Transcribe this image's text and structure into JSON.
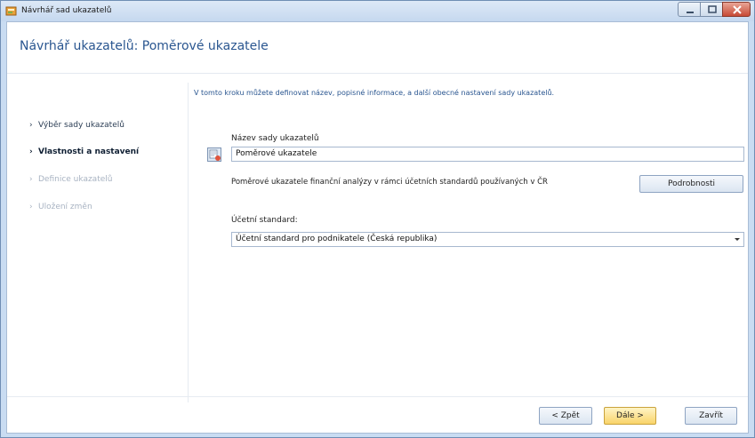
{
  "window": {
    "title": "Návrhář sad ukazatelů",
    "controls": {
      "minimize": "minimize-icon",
      "maximize": "maximize-icon",
      "close": "close-icon"
    }
  },
  "header": {
    "title": "Návrhář ukazatelů: Poměrové ukazatele"
  },
  "steps": [
    {
      "label": "Výběr sady ukazatelů",
      "state": "done"
    },
    {
      "label": "Vlastnosti a nastavení",
      "state": "active"
    },
    {
      "label": "Definice ukazatelů",
      "state": "disabled"
    },
    {
      "label": "Uložení změn",
      "state": "disabled"
    }
  ],
  "content": {
    "intro": "V tomto kroku můžete definovat název, popisné informace, a další obecné nastavení sady ukazatelů.",
    "name_label": "Název sady ukazatelů",
    "name_value": "Poměrové ukazatele",
    "description": "Poměrové ukazatele finanční analýzy v rámci účetních standardů používaných v ČR",
    "details_button": "Podrobnosti",
    "standard_label": "Účetní standard:",
    "standard_value": "Účetní standard pro podnikatele (Česká republika)"
  },
  "footer": {
    "back": "< Zpět",
    "next": "Dále >",
    "close": "Zavřít"
  },
  "colors": {
    "accent": "#2a5690",
    "primary_button": "#f9d46a",
    "frame": "#c9dcf2"
  }
}
